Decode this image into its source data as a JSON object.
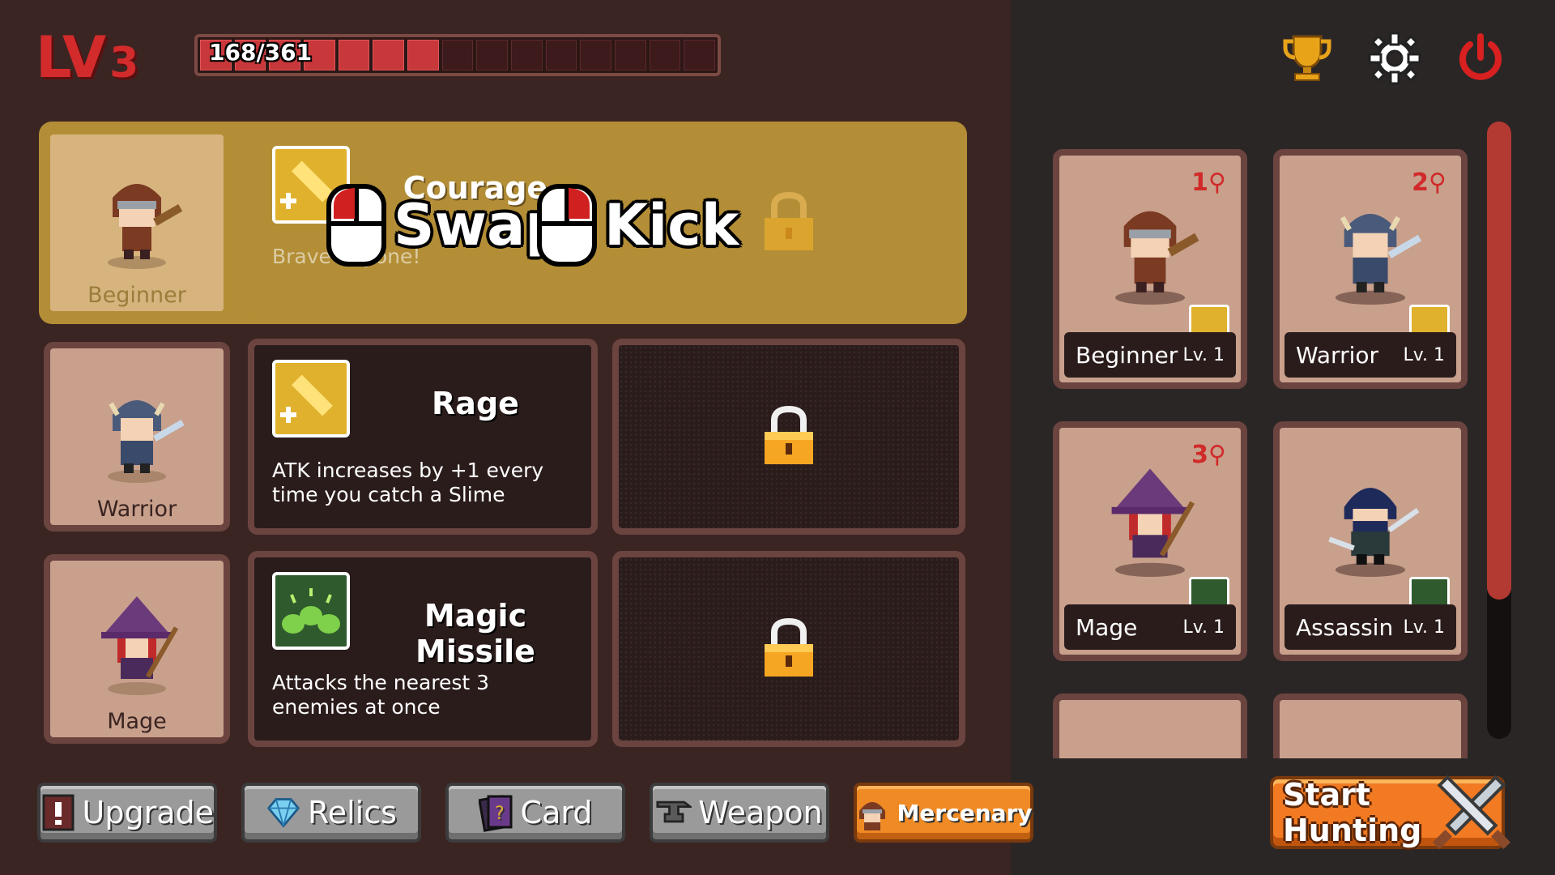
{
  "hud": {
    "level_prefix": "LV",
    "level": "3",
    "xp_text": "168/361",
    "xp_current": 168,
    "xp_max": 361,
    "xp_segments_total": 15,
    "xp_segments_filled": 7
  },
  "header_icons": [
    "trophy-icon",
    "gear-icon",
    "power-icon"
  ],
  "slots": [
    {
      "class_name": "Beginner",
      "skill_name": "Courage",
      "skill_desc": "Brave anyone!",
      "skill_icon": "sword-plus-icon",
      "selected": true
    },
    {
      "class_name": "Warrior",
      "skill_name": "Rage",
      "skill_desc": "ATK increases by +1 every time you catch a Slime",
      "skill_icon": "sword-plus-icon",
      "selected": false
    },
    {
      "class_name": "Mage",
      "skill_name": "Magic Missile",
      "skill_desc": "Attacks the nearest 3 enemies at once",
      "skill_icon": "slime-trio-icon",
      "selected": false
    }
  ],
  "overlay": {
    "swap_label": "Swap",
    "kick_label": "Kick"
  },
  "mercenaries": [
    {
      "name": "Beginner",
      "level": "Lv. 1",
      "rank": "1"
    },
    {
      "name": "Warrior",
      "level": "Lv. 1",
      "rank": "2"
    },
    {
      "name": "Mage",
      "level": "Lv. 1",
      "rank": "3"
    },
    {
      "name": "Assassin",
      "level": "Lv. 1",
      "rank": ""
    }
  ],
  "tabs": [
    {
      "label": "Upgrade",
      "active": false
    },
    {
      "label": "Relics",
      "active": false
    },
    {
      "label": "Card",
      "active": false
    },
    {
      "label": "Weapon",
      "active": false
    },
    {
      "label": "Mercenary",
      "active": true
    }
  ],
  "start_button": "Start Hunting",
  "colors": {
    "accent_red": "#d32b2b",
    "gold_selected": "#b38e36",
    "tab_active": "#f08a24",
    "frame_brown": "#6b4440"
  }
}
